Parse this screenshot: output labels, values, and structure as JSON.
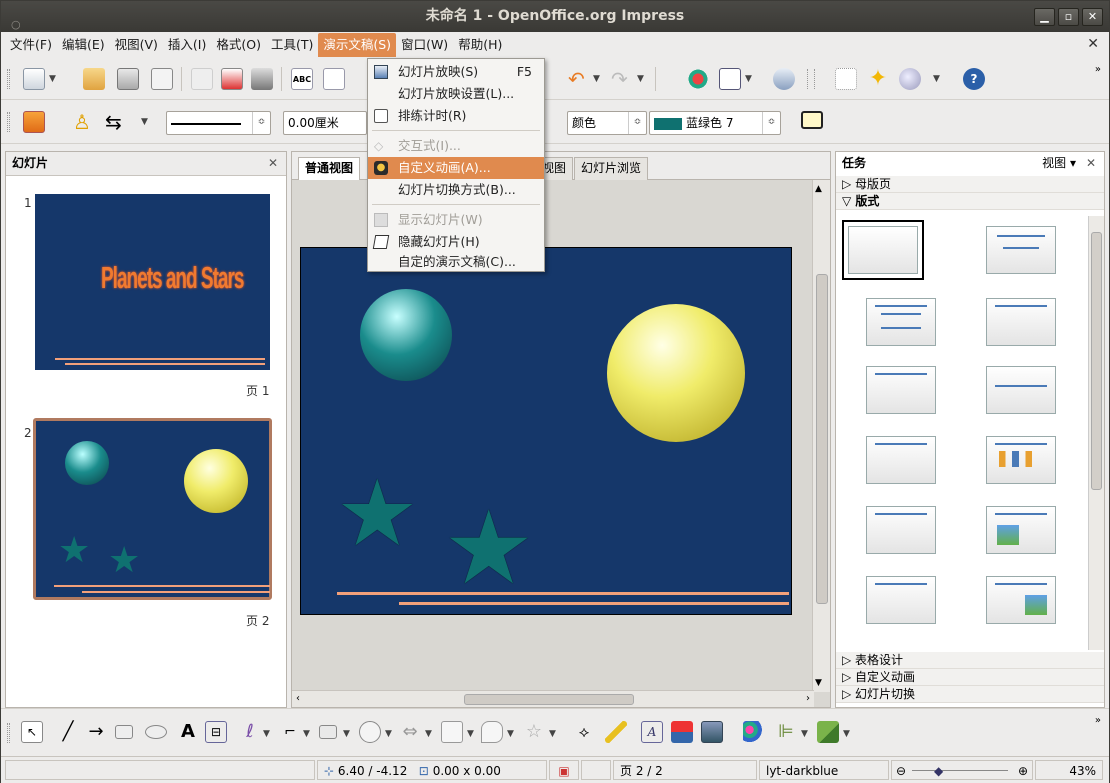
{
  "window": {
    "title": "未命名 1 - OpenOffice.org Impress"
  },
  "menubar": {
    "items": [
      {
        "label": "文件(F)"
      },
      {
        "label": "编辑(E)"
      },
      {
        "label": "视图(V)"
      },
      {
        "label": "插入(I)"
      },
      {
        "label": "格式(O)"
      },
      {
        "label": "工具(T)"
      },
      {
        "label": "演示文稿(S)"
      },
      {
        "label": "窗口(W)"
      },
      {
        "label": "帮助(H)"
      }
    ]
  },
  "dropdown": {
    "items": [
      {
        "label": "幻灯片放映(S)",
        "shortcut": "F5"
      },
      {
        "label": "幻灯片放映设置(L)..."
      },
      {
        "label": "排练计时(R)"
      },
      {
        "label": "交互式(I)..."
      },
      {
        "label": "自定义动画(A)..."
      },
      {
        "label": "幻灯片切换方式(B)..."
      },
      {
        "label": "显示幻灯片(W)"
      },
      {
        "label": "隐藏幻灯片(H)"
      },
      {
        "label": "自定的演示文稿(C)..."
      }
    ]
  },
  "toolbar2": {
    "line_width": "0.00厘米",
    "area_style": "颜色",
    "fill_color": "蓝绿色 7"
  },
  "slides_pane": {
    "title": "幻灯片",
    "slides": [
      {
        "number": "1",
        "page_label": "页 1",
        "title_art": "Planets and Stars"
      },
      {
        "number": "2",
        "page_label": "页 2"
      }
    ]
  },
  "view_tabs": {
    "items": [
      {
        "label": "普通视图"
      },
      {
        "label": "视图"
      },
      {
        "label": "幻灯片浏览"
      }
    ]
  },
  "tasks_pane": {
    "title": "任务",
    "view_label": "视图",
    "sections": {
      "master": "母版页",
      "layouts": "版式",
      "table_design": "表格设计",
      "custom_animation": "自定义动画",
      "slide_transition": "幻灯片切换"
    }
  },
  "statusbar": {
    "position": "6.40 / -4.12",
    "size": "0.00 x 0.00",
    "page": "页 2 / 2",
    "master": "lyt-darkblue",
    "zoom": "43%"
  },
  "colors": {
    "slide_bg": "#15376a",
    "menu_highlight": "#e08a4e",
    "teal_star": "#0f7170",
    "accent_line": "#f2a07a"
  }
}
